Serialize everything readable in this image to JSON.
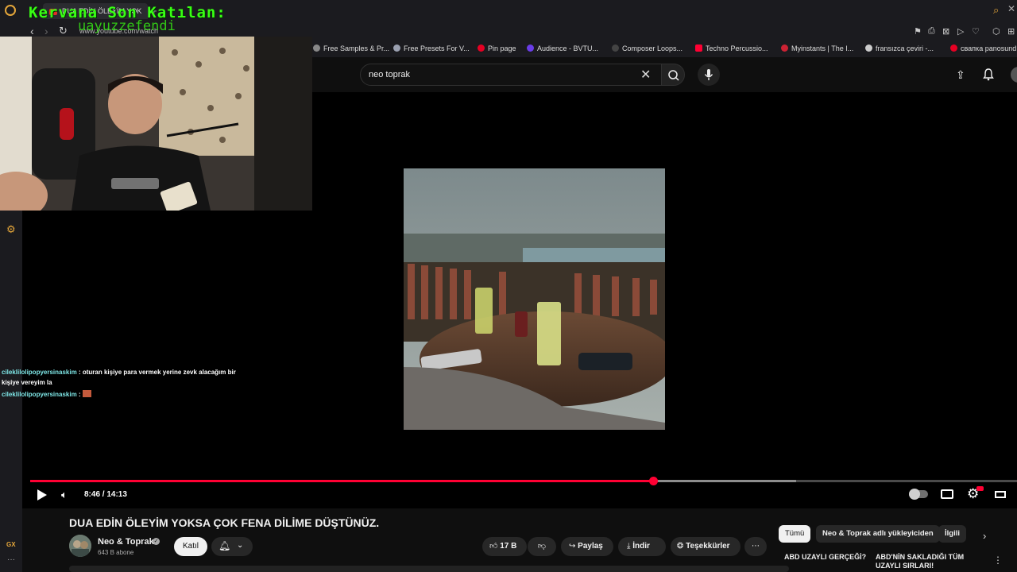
{
  "browser": {
    "tab_title": "DUA EDİN ÖLEYİM YOK",
    "url": "www.youtube.com/watch",
    "bookmarks": [
      {
        "label": "Free Samples & Pr...",
        "color": "#888888"
      },
      {
        "label": "Free Presets For V...",
        "color": "#9aa0b0"
      },
      {
        "label": "Pin page",
        "color": "#e60023"
      },
      {
        "label": "Audience - BVTU...",
        "color": "#6a3de8"
      },
      {
        "label": "Composer Loops...",
        "color": "#444444"
      },
      {
        "label": "Techno Percussio...",
        "color": "#ff0033"
      },
      {
        "label": "Myinstants | The I...",
        "color": "#cc2233"
      },
      {
        "label": "fransızca çeviri -...",
        "color": "#cccccc"
      },
      {
        "label": "свапка panosund",
        "color": "#e60023"
      }
    ]
  },
  "overlay": {
    "title": "Kervana Son Katılan:",
    "user": "uayuzzefendi"
  },
  "chat": [
    {
      "user": "cileklilolipopyersinaskim",
      "message": ": oturan kişiye para vermek yerine zevk alacağım bir kişiye vereyim la"
    },
    {
      "user": "cileklilolipopyersinaskim",
      "message": ":"
    }
  ],
  "search": {
    "query": "neo toprak"
  },
  "player": {
    "time": "8:46 / 14:13",
    "progress": 0.617
  },
  "video": {
    "title": "DUA EDİN ÖLEYİM YOKSA ÇOK FENA DİLİME DÜŞTÜNÜZ.",
    "channel": "Neo & Toprak",
    "subscribers": "643 B abone",
    "join_label": "Katıl",
    "likes": "17 B",
    "share_label": "Paylaş",
    "download_label": "İndir",
    "thanks_label": "Teşekkürler"
  },
  "chips": [
    "Tümü",
    "Neo & Toprak adlı yükleyiciden",
    "İlgili"
  ],
  "recommendations": [
    {
      "title": "ABD UZAYLI GERÇEĞİ?"
    },
    {
      "title": "ABD'NİN SAKLADIĞI TÜM UZAYLI SIRLARI!"
    }
  ],
  "colors": {
    "accent": "#ff0033",
    "overlay_green": "#39ff14",
    "opera": "#e3a53a"
  }
}
